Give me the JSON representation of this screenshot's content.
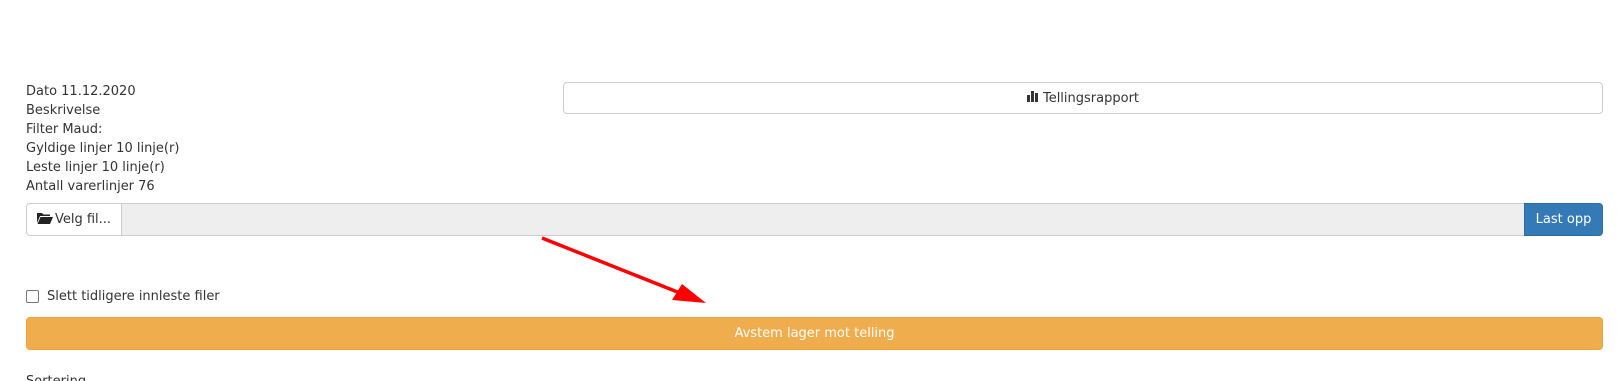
{
  "info": {
    "dato": "Dato 11.12.2020",
    "beskrivelse": "Beskrivelse",
    "filter": "Filter Maud:",
    "gyldige": "Gyldige linjer 10 linje(r)",
    "leste": "Leste linjer 10 linje(r)",
    "antall": "Antall varerlinjer 76"
  },
  "report_button": {
    "label": "Tellingsrapport",
    "icon": "bar-chart-icon"
  },
  "upload": {
    "choose_label": "Velg fil...",
    "choose_icon": "folder-open-icon",
    "file_value": "",
    "upload_label": "Last opp"
  },
  "checkbox": {
    "label": "Slett tidligere innleste filer",
    "checked": false
  },
  "reconcile_button": {
    "label": "Avstem lager mot telling"
  },
  "sort": {
    "label": "Sortering"
  },
  "colors": {
    "primary": "#337ab7",
    "warning": "#f0ad4e",
    "annotation_arrow": "#ff0000"
  }
}
